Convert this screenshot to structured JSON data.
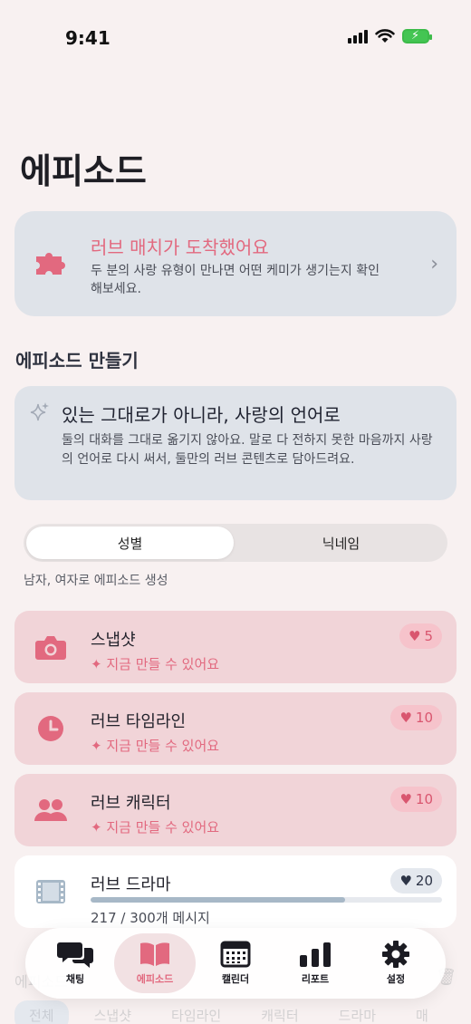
{
  "status": {
    "time": "9:41"
  },
  "page_title": "에피소드",
  "match_card": {
    "title": "러브 매치가 도착했어요",
    "description": "두 분의 사랑 유형이 만나면 어떤 케미가 생기는지 확인해보세요.",
    "chevron": "›"
  },
  "section_title": "에피소드 만들기",
  "lang_card": {
    "title": "있는 그대로가 아니라, 사랑의 언어로",
    "description": "둘의 대화를 그대로 옮기지 않아요. 말로 다 전하지 못한 마음까지 사랑의 언어로 다시 써서, 둘만의 러브 콘텐츠로 담아드려요."
  },
  "segment": {
    "options": [
      "성별",
      "닉네임"
    ],
    "selected": "성별",
    "caption": "남자, 여자로 에피소드 생성"
  },
  "episodes": [
    {
      "name": "스냅샷",
      "status": "지금 만들 수 있어요",
      "cost": "5",
      "icon": "camera-icon"
    },
    {
      "name": "러브 타임라인",
      "status": "지금 만들 수 있어요",
      "cost": "10",
      "icon": "clock-icon"
    },
    {
      "name": "러브 캐릭터",
      "status": "지금 만들 수 있어요",
      "cost": "10",
      "icon": "people-icon"
    },
    {
      "name": "러브 드라마",
      "progress_text": "217 / 300개 메시지",
      "progress": 0.723,
      "cost": "20",
      "icon": "film-icon"
    }
  ],
  "ghost": {
    "label": "에피소드",
    "filters": [
      "전체",
      "스냅샷",
      "타임라인",
      "캐릭터",
      "드라마",
      "매"
    ]
  },
  "tabs": [
    {
      "label": "채팅",
      "icon": "chat-bubbles-icon"
    },
    {
      "label": "에피소드",
      "icon": "book-icon",
      "active": true
    },
    {
      "label": "캘린더",
      "icon": "calendar-icon"
    },
    {
      "label": "리포트",
      "icon": "bar-chart-icon"
    },
    {
      "label": "설정",
      "icon": "gear-icon"
    }
  ],
  "colors": {
    "accent": "#e2697f",
    "card_pink": "#f1d4d8",
    "card_gray": "#dfe3e9",
    "background": "#f8f1f1"
  }
}
